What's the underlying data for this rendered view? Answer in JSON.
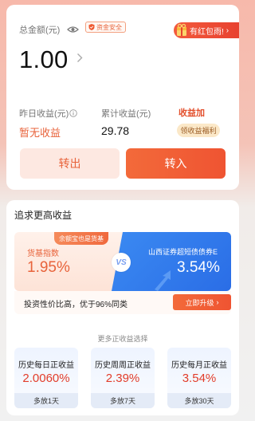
{
  "asset": {
    "total_label": "总金额(元)",
    "safe_badge": "资金安全",
    "promo": "有红包雨!",
    "balance": "1.00",
    "yesterday_label": "昨日收益(元)",
    "yesterday_value": "暂无收益",
    "cumulative_label": "累计收益(元)",
    "cumulative_value": "29.78",
    "boost_title": "收益加",
    "boost_pill": "领收益福利",
    "transfer_out": "转出",
    "transfer_in": "转入"
  },
  "higher": {
    "title": "追求更高收益",
    "left_tag": "余额宝也是货基",
    "left_name": "货基指数",
    "left_rate": "1.95%",
    "vs": "VS",
    "right_name": "山西证券超短债债券E",
    "right_rate": "3.54%",
    "upgrade_text": "投资性价比高，优于96%同类",
    "upgrade_button": "立即升级"
  },
  "more": {
    "title": "更多正收益选择",
    "cards": [
      {
        "title": "历史每日正收益",
        "rate": "2.0060%",
        "foot": "多放1天"
      },
      {
        "title": "历史周周正收益",
        "rate": "2.39%",
        "foot": "多放7天"
      },
      {
        "title": "历史每月正收益",
        "rate": "3.54%",
        "foot": "多放30天"
      }
    ]
  },
  "colors": {
    "accent": "#ef5432",
    "accent_text": "#e8633b",
    "blue": "#2a6de6"
  },
  "icons": [
    "eye-icon",
    "shield-icon",
    "gift-icon",
    "chevron-right-icon",
    "info-icon",
    "up-arrow-icon"
  ]
}
